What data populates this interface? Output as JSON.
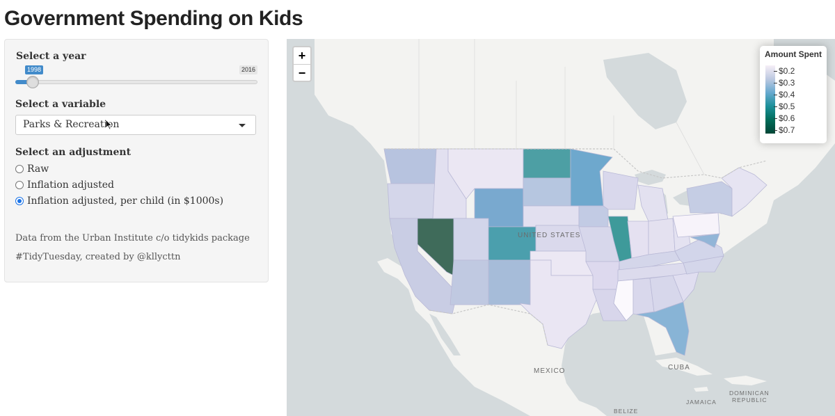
{
  "page": {
    "title": "Government Spending on Kids"
  },
  "sidebar": {
    "year": {
      "label": "Select a year",
      "min_label": "1998",
      "max_label": "2016",
      "selected": "1998",
      "min": 1998,
      "max": 2016,
      "value": 1998
    },
    "variable": {
      "label": "Select a variable",
      "selected": "Parks & Recreation"
    },
    "adjustment": {
      "label": "Select an adjustment",
      "options": [
        {
          "label": "Raw",
          "checked": false
        },
        {
          "label": "Inflation adjusted",
          "checked": false
        },
        {
          "label": "Inflation adjusted, per child (in $1000s)",
          "checked": true
        }
      ]
    },
    "notes": [
      "Data from the Urban Institute c/o tidykids package",
      "#TidyTuesday, created by @kllycttn"
    ]
  },
  "map": {
    "zoom_in": "+",
    "zoom_out": "−",
    "legend": {
      "title": "Amount Spent",
      "labels": [
        "$0.2",
        "$0.3",
        "$0.4",
        "$0.5",
        "$0.6",
        "$0.7"
      ],
      "colors": [
        "#f6eff7",
        "#bdc9e1",
        "#67a9cf",
        "#1c9099",
        "#016c59",
        "#014636"
      ]
    },
    "place_labels": {
      "united_states": "UNITED STATES",
      "mexico": "MEXICO",
      "cuba": "CUBA",
      "dominican_republic_1": "DOMINICAN",
      "dominican_republic_2": "REPUBLIC",
      "jamaica": "JAMAICA",
      "belize": "BELIZE"
    }
  }
}
